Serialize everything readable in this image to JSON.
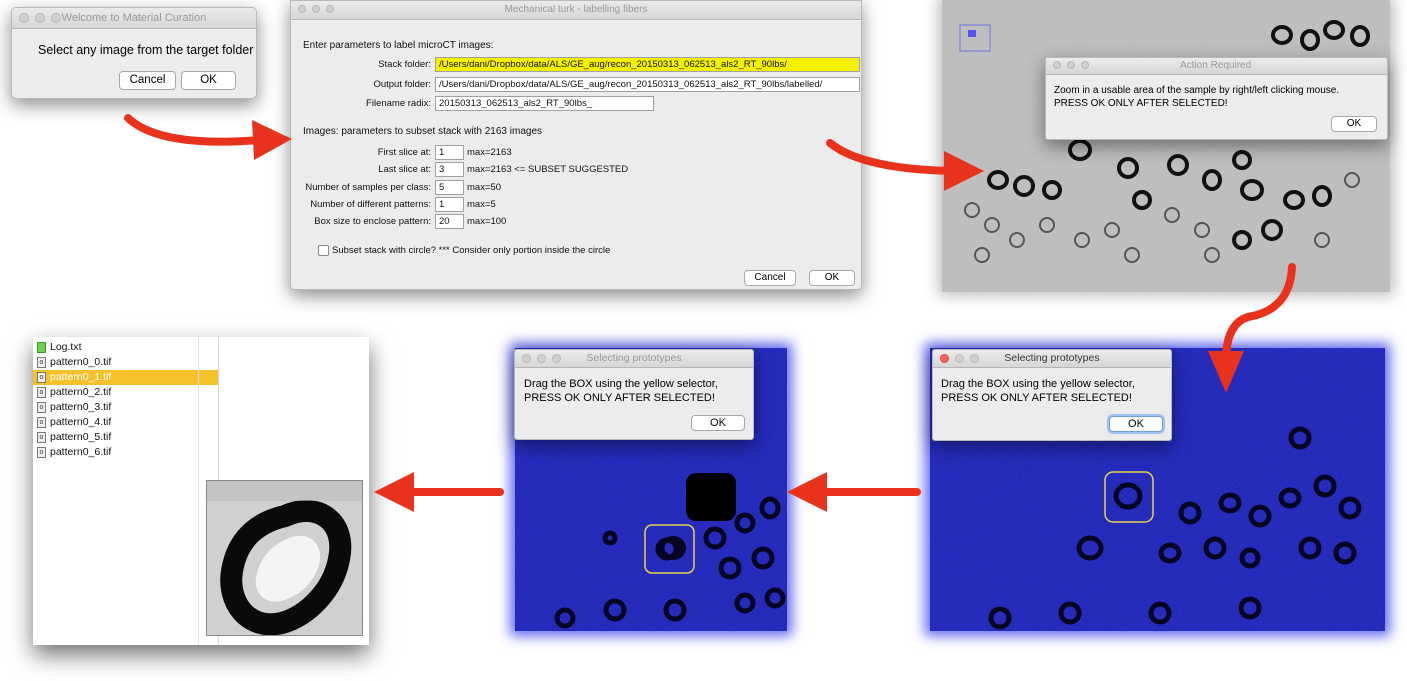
{
  "welcome": {
    "title": "Welcome to Material Curation",
    "message": "Select any image from the target folder",
    "cancel": "Cancel",
    "ok": "OK"
  },
  "params": {
    "title": "Mechanical turk - labelling fibers",
    "heading": "Enter parameters to label microCT images:",
    "stack_label": "Stack folder:",
    "stack_value": "/Users/dani/Dropbox/data/ALS/GE_aug/recon_20150313_062513_als2_RT_90lbs/",
    "output_label": "Output folder:",
    "output_value": "/Users/dani/Dropbox/data/ALS/GE_aug/recon_20150313_062513_als2_RT_90lbs/labelled/",
    "radix_label": "Filename radix:",
    "radix_value": "20150313_062513_als2_RT_90lbs_",
    "subset_heading": "Images: parameters to subset stack with 2163 images",
    "first_label": "First slice at:",
    "first_value": "1",
    "first_note": "max=2163",
    "last_label": "Last slice at:",
    "last_value": "3",
    "last_note": "max=2163 <= SUBSET SUGGESTED",
    "samples_label": "Number of samples per class:",
    "samples_value": "5",
    "samples_note": "max=50",
    "patterns_label": "Number of different patterns:",
    "patterns_value": "1",
    "patterns_note": "max=5",
    "box_label": "Box size to enclose pattern:",
    "box_value": "20",
    "box_note": "max=100",
    "checkbox_label": "Subset stack with circle? *** Consider only portion inside the circle",
    "cancel": "Cancel",
    "ok": "OK"
  },
  "action": {
    "title": "Action Required",
    "message_1": "Zoom in a usable area of the sample by right/left clicking mouse.",
    "message_2": "PRESS OK ONLY AFTER SELECTED!",
    "ok": "OK"
  },
  "proto_right": {
    "title": "Selecting prototypes",
    "message_1": "Drag the BOX using the yellow selector,",
    "message_2": "PRESS OK ONLY AFTER SELECTED!",
    "ok": "OK"
  },
  "proto_mid": {
    "title": "Selecting prototypes",
    "message_1": "Drag the BOX using the yellow selector,",
    "message_2": "PRESS OK ONLY AFTER SELECTED!",
    "ok": "OK"
  },
  "finder": {
    "files": [
      "Log.txt",
      "pattern0_0.tif",
      "pattern0_1.tif",
      "pattern0_2.tif",
      "pattern0_3.tif",
      "pattern0_4.tif",
      "pattern0_5.tif",
      "pattern0_6.tif"
    ],
    "selected_index": 2
  },
  "colors": {
    "arrow": "#e8321c",
    "highlight_field": "#f4f000",
    "selected_row": "#f6c02a",
    "blue_image": "#1a22c8"
  }
}
